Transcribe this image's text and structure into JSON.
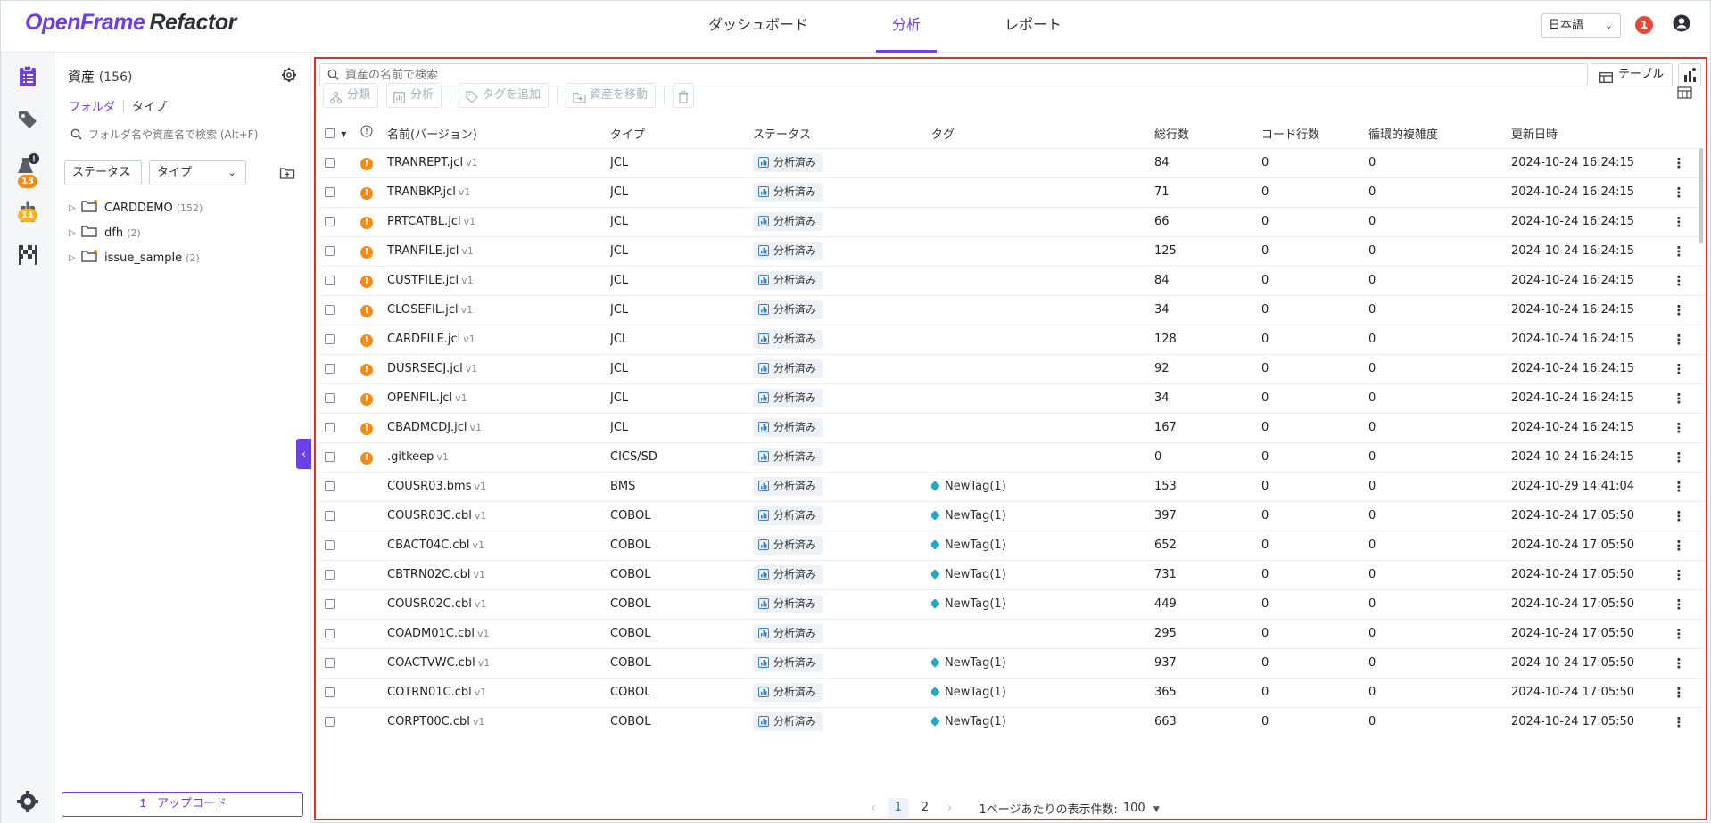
{
  "app": {
    "logo_part1": "OpenFrame",
    "logo_part2": "Refactor"
  },
  "nav": {
    "items": [
      {
        "label": "ダッシュボード"
      },
      {
        "label": "分析"
      },
      {
        "label": "レポート"
      }
    ],
    "active": "分析"
  },
  "header": {
    "language": "日本語",
    "notification_count": "1"
  },
  "rail": {
    "badges": [
      "13",
      "11"
    ]
  },
  "panel": {
    "title": "資産",
    "count": "(156)",
    "tabs": [
      "フォルダ",
      "タイプ"
    ],
    "search_placeholder": "フォルダ名や資産名で検索 (Alt+F)",
    "filter_status": "ステータス",
    "filter_type": "タイプ",
    "tree": [
      {
        "name": "CARDDEMO",
        "count": "(152)"
      },
      {
        "name": "dfh",
        "count": "(2)"
      },
      {
        "name": "issue_sample",
        "count": "(2)"
      }
    ],
    "upload_label": "アップロード"
  },
  "main": {
    "search_placeholder": "資産の名前で検索",
    "view_label": "テーブル",
    "actions": {
      "classify": "分類",
      "analyze": "分析",
      "add_tag": "タグを追加",
      "move": "資産を移動"
    },
    "columns": {
      "name": "名前(バージョン)",
      "type": "タイプ",
      "status": "ステータス",
      "tag": "タグ",
      "total_lines": "総行数",
      "code_lines": "コード行数",
      "complexity": "循環的複雑度",
      "updated": "更新日時"
    },
    "rows": [
      {
        "warn": true,
        "name": "TRANREPT.jcl",
        "ver": "v1",
        "type": "JCL",
        "status": "分析済み",
        "tag": "",
        "total": "84",
        "code": "0",
        "complexity": "0",
        "updated": "2024-10-24 16:24:15"
      },
      {
        "warn": true,
        "name": "TRANBKP.jcl",
        "ver": "v1",
        "type": "JCL",
        "status": "分析済み",
        "tag": "",
        "total": "71",
        "code": "0",
        "complexity": "0",
        "updated": "2024-10-24 16:24:15"
      },
      {
        "warn": true,
        "name": "PRTCATBL.jcl",
        "ver": "v1",
        "type": "JCL",
        "status": "分析済み",
        "tag": "",
        "total": "66",
        "code": "0",
        "complexity": "0",
        "updated": "2024-10-24 16:24:15"
      },
      {
        "warn": true,
        "name": "TRANFILE.jcl",
        "ver": "v1",
        "type": "JCL",
        "status": "分析済み",
        "tag": "",
        "total": "125",
        "code": "0",
        "complexity": "0",
        "updated": "2024-10-24 16:24:15"
      },
      {
        "warn": true,
        "name": "CUSTFILE.jcl",
        "ver": "v1",
        "type": "JCL",
        "status": "分析済み",
        "tag": "",
        "total": "84",
        "code": "0",
        "complexity": "0",
        "updated": "2024-10-24 16:24:15"
      },
      {
        "warn": true,
        "name": "CLOSEFIL.jcl",
        "ver": "v1",
        "type": "JCL",
        "status": "分析済み",
        "tag": "",
        "total": "34",
        "code": "0",
        "complexity": "0",
        "updated": "2024-10-24 16:24:15"
      },
      {
        "warn": true,
        "name": "CARDFILE.jcl",
        "ver": "v1",
        "type": "JCL",
        "status": "分析済み",
        "tag": "",
        "total": "128",
        "code": "0",
        "complexity": "0",
        "updated": "2024-10-24 16:24:15"
      },
      {
        "warn": true,
        "name": "DUSRSECJ.jcl",
        "ver": "v1",
        "type": "JCL",
        "status": "分析済み",
        "tag": "",
        "total": "92",
        "code": "0",
        "complexity": "0",
        "updated": "2024-10-24 16:24:15"
      },
      {
        "warn": true,
        "name": "OPENFIL.jcl",
        "ver": "v1",
        "type": "JCL",
        "status": "分析済み",
        "tag": "",
        "total": "34",
        "code": "0",
        "complexity": "0",
        "updated": "2024-10-24 16:24:15"
      },
      {
        "warn": true,
        "name": "CBADMCDJ.jcl",
        "ver": "v1",
        "type": "JCL",
        "status": "分析済み",
        "tag": "",
        "total": "167",
        "code": "0",
        "complexity": "0",
        "updated": "2024-10-24 16:24:15"
      },
      {
        "warn": true,
        "name": ".gitkeep",
        "ver": "v1",
        "type": "CICS/SD",
        "status": "分析済み",
        "tag": "",
        "total": "0",
        "code": "0",
        "complexity": "0",
        "updated": "2024-10-24 16:24:15"
      },
      {
        "warn": false,
        "name": "COUSR03.bms",
        "ver": "v1",
        "type": "BMS",
        "status": "分析済み",
        "tag": "NewTag(1)",
        "total": "153",
        "code": "0",
        "complexity": "0",
        "updated": "2024-10-29 14:41:04"
      },
      {
        "warn": false,
        "name": "COUSR03C.cbl",
        "ver": "v1",
        "type": "COBOL",
        "status": "分析済み",
        "tag": "NewTag(1)",
        "total": "397",
        "code": "0",
        "complexity": "0",
        "updated": "2024-10-24 17:05:50"
      },
      {
        "warn": false,
        "name": "CBACT04C.cbl",
        "ver": "v1",
        "type": "COBOL",
        "status": "分析済み",
        "tag": "NewTag(1)",
        "total": "652",
        "code": "0",
        "complexity": "0",
        "updated": "2024-10-24 17:05:50"
      },
      {
        "warn": false,
        "name": "CBTRN02C.cbl",
        "ver": "v1",
        "type": "COBOL",
        "status": "分析済み",
        "tag": "NewTag(1)",
        "total": "731",
        "code": "0",
        "complexity": "0",
        "updated": "2024-10-24 17:05:50"
      },
      {
        "warn": false,
        "name": "COUSR02C.cbl",
        "ver": "v1",
        "type": "COBOL",
        "status": "分析済み",
        "tag": "NewTag(1)",
        "total": "449",
        "code": "0",
        "complexity": "0",
        "updated": "2024-10-24 17:05:50"
      },
      {
        "warn": false,
        "name": "COADM01C.cbl",
        "ver": "v1",
        "type": "COBOL",
        "status": "分析済み",
        "tag": "",
        "total": "295",
        "code": "0",
        "complexity": "0",
        "updated": "2024-10-24 17:05:50"
      },
      {
        "warn": false,
        "name": "COACTVWC.cbl",
        "ver": "v1",
        "type": "COBOL",
        "status": "分析済み",
        "tag": "NewTag(1)",
        "total": "937",
        "code": "0",
        "complexity": "0",
        "updated": "2024-10-24 17:05:50"
      },
      {
        "warn": false,
        "name": "COTRN01C.cbl",
        "ver": "v1",
        "type": "COBOL",
        "status": "分析済み",
        "tag": "NewTag(1)",
        "total": "365",
        "code": "0",
        "complexity": "0",
        "updated": "2024-10-24 17:05:50"
      },
      {
        "warn": false,
        "name": "CORPT00C.cbl",
        "ver": "v1",
        "type": "COBOL",
        "status": "分析済み",
        "tag": "NewTag(1)",
        "total": "663",
        "code": "0",
        "complexity": "0",
        "updated": "2024-10-24 17:05:50"
      }
    ]
  },
  "pagination": {
    "pages": [
      "1",
      "2"
    ],
    "current": "1",
    "per_page_label": "1ページあたりの表示件数:",
    "per_page_value": "100"
  },
  "colors": {
    "accent": "#6d3fe6",
    "warning": "#f08c1c",
    "notification": "#e8483a",
    "tag": "#27a7c7",
    "highlight_border": "#d9342b"
  }
}
